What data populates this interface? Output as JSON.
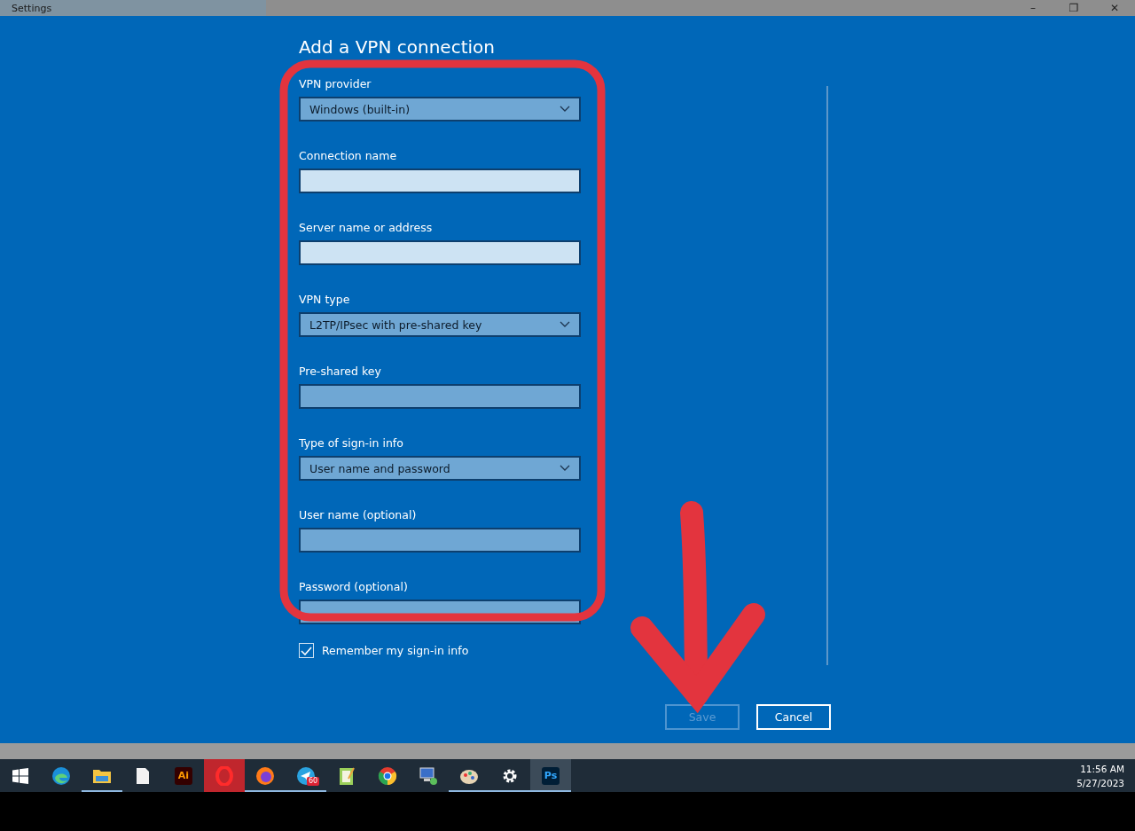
{
  "window": {
    "title": "Settings",
    "controls": [
      "–",
      "❐",
      "✕"
    ]
  },
  "dialog": {
    "title": "Add a VPN connection",
    "fields": [
      {
        "kind": "dropdown",
        "label": "VPN provider",
        "value": "Windows (built-in)",
        "focused": false
      },
      {
        "kind": "text",
        "label": "Connection name",
        "focused": true
      },
      {
        "kind": "text",
        "label": "Server name or address",
        "focused": true
      },
      {
        "kind": "dropdown",
        "label": "VPN type",
        "value": "L2TP/IPsec with pre-shared key",
        "focused": false
      },
      {
        "kind": "text",
        "label": "Pre-shared key",
        "focused": false
      },
      {
        "kind": "dropdown",
        "label": "Type of sign-in info",
        "value": "User name and password",
        "focused": false
      },
      {
        "kind": "text",
        "label": "User name (optional)",
        "focused": false
      },
      {
        "kind": "text",
        "label": "Password (optional)",
        "focused": false
      }
    ],
    "remember": {
      "label": "Remember my sign-in info",
      "checked": true
    },
    "buttons": [
      {
        "label": "Save",
        "disabled": true
      },
      {
        "label": "Cancel",
        "disabled": false
      }
    ]
  },
  "taskbar": {
    "items": [
      {
        "running": false,
        "selected": false
      },
      {
        "running": false,
        "selected": false
      },
      {
        "running": true,
        "selected": false
      },
      {
        "running": false,
        "selected": false
      },
      {
        "running": false,
        "selected": false,
        "label": "Ai"
      },
      {
        "running": false,
        "selected": true
      },
      {
        "running": true,
        "selected": false
      },
      {
        "running": true,
        "selected": false,
        "badge": "60"
      },
      {
        "running": false,
        "selected": false
      },
      {
        "running": false,
        "selected": false
      },
      {
        "running": false,
        "selected": false
      },
      {
        "running": true,
        "selected": false
      },
      {
        "running": true,
        "selected": false
      },
      {
        "running": true,
        "selected": true,
        "label": "Ps"
      }
    ],
    "time": "11:56 AM",
    "date": "5/27/2023"
  }
}
